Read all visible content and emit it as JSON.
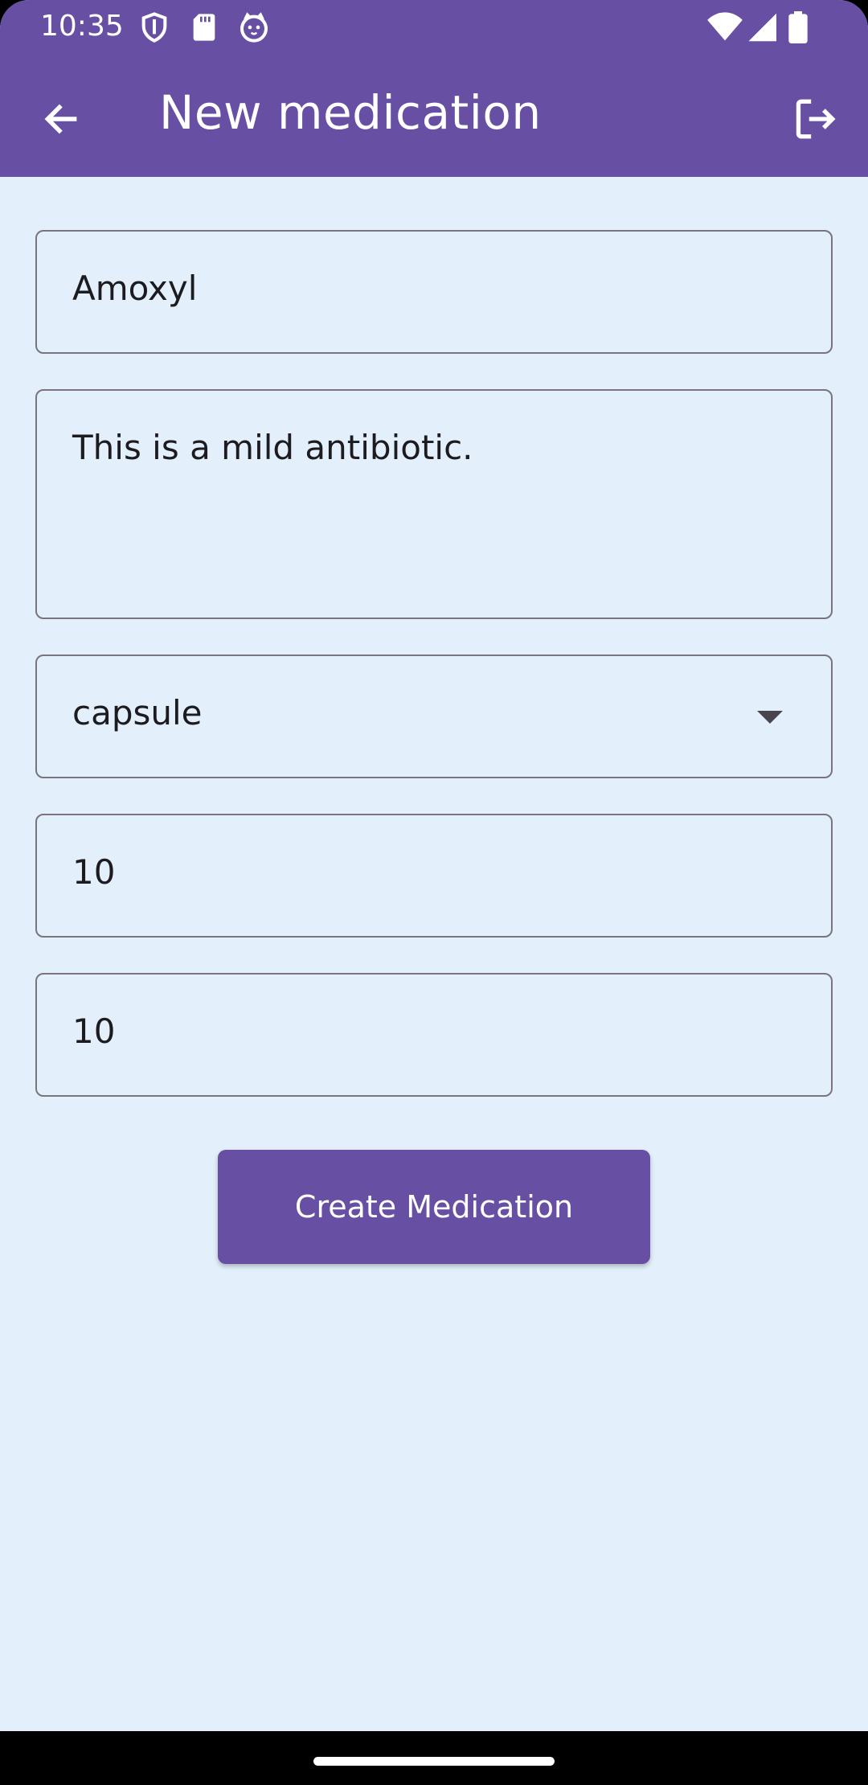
{
  "status_bar": {
    "time": "10:35",
    "icons": [
      "shield-icon",
      "sd-card-icon",
      "cat-icon",
      "wifi-icon",
      "signal-icon",
      "battery-icon"
    ]
  },
  "app_bar": {
    "title": "New medication",
    "back_icon": "arrow-left-icon",
    "logout_icon": "logout-icon",
    "color": "#6750A4"
  },
  "form": {
    "name_value": "Amoxyl",
    "description_value": "This is a mild antibiotic.",
    "form_type_value": "capsule",
    "quantity_value": "10",
    "dosage_value": "10"
  },
  "actions": {
    "create_label": "Create Medication"
  },
  "colors": {
    "background": "#E3F0FB",
    "accent": "#6750A4",
    "outline": "#79747E"
  }
}
